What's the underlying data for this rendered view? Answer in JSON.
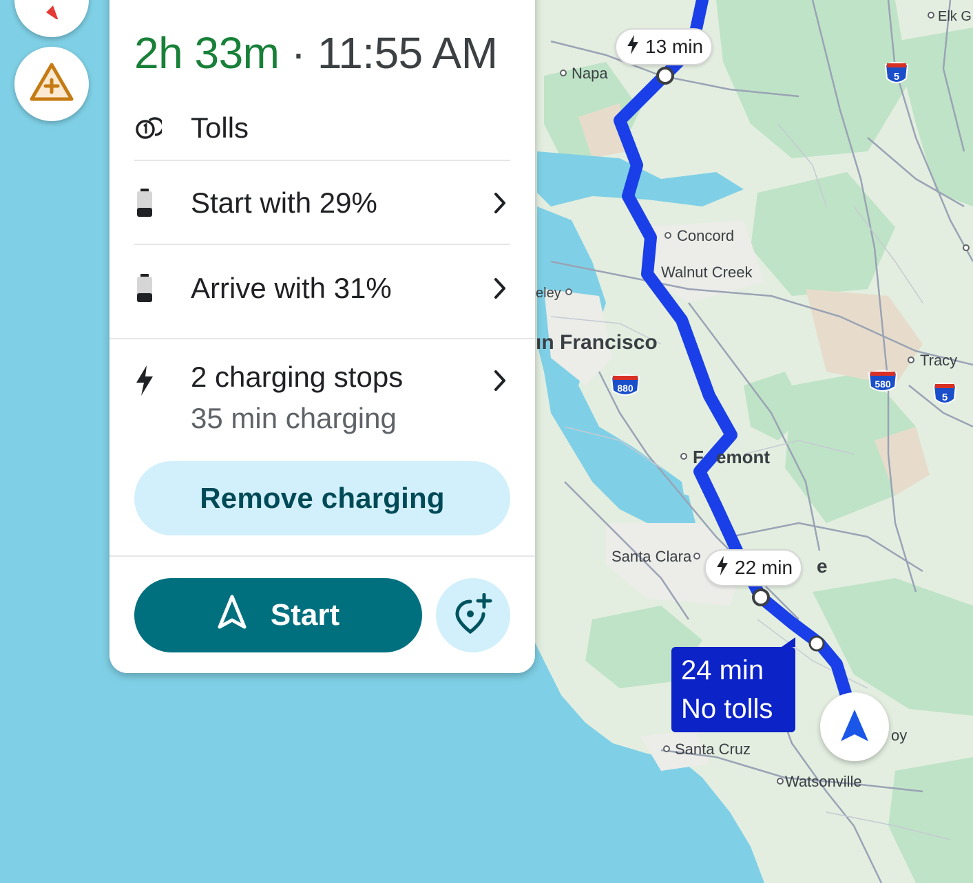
{
  "route": {
    "duration": "2h 33m",
    "separator": "·",
    "arrival_time": "11:55 AM",
    "tolls_label": "Tolls",
    "start_battery": "Start with 29%",
    "arrive_battery": "Arrive with 31%",
    "charging_stops": "2 charging stops",
    "charging_time": "35 min charging",
    "remove_charging": "Remove charging",
    "start_label": "Start"
  },
  "map": {
    "charge_stop_1": "13 min",
    "charge_stop_2": "22 min",
    "alt_route_time": "24 min",
    "alt_route_note": "No tolls",
    "places": {
      "elk": "Elk G",
      "napa": "Napa",
      "concord": "Concord",
      "walnut_creek": "Walnut Creek",
      "berkeley": "eley",
      "san_francisco": "ın Francisco",
      "tracy": "Tracy",
      "fremont_a": "F",
      "fremont_b": "emont",
      "santa_clara": "Santa Clara",
      "san_jose_frag": "e",
      "santa_cruz": "Santa Cruz",
      "gilroy_frag": "oy",
      "watsonville": "Watsonville"
    },
    "shields": {
      "i5_north": "5",
      "i880": "880",
      "i580": "580",
      "i5_south": "5"
    }
  },
  "icons": {
    "compass": "compass-icon",
    "report": "report-incident-icon",
    "tolls": "toll-coins-icon",
    "battery": "battery-icon",
    "bolt": "lightning-bolt-icon",
    "chevron": "chevron-right-icon",
    "navigation": "navigation-arrow-icon",
    "add_stop": "add-stop-pin-icon"
  },
  "colors": {
    "duration_green": "#188038",
    "route_blue": "#1a3fe8",
    "alt_route_card": "#0c23c8",
    "start_button": "#00707f",
    "tonal_button": "#d2f0fb",
    "water": "#7fd0e6",
    "land": "#e4efe2"
  }
}
